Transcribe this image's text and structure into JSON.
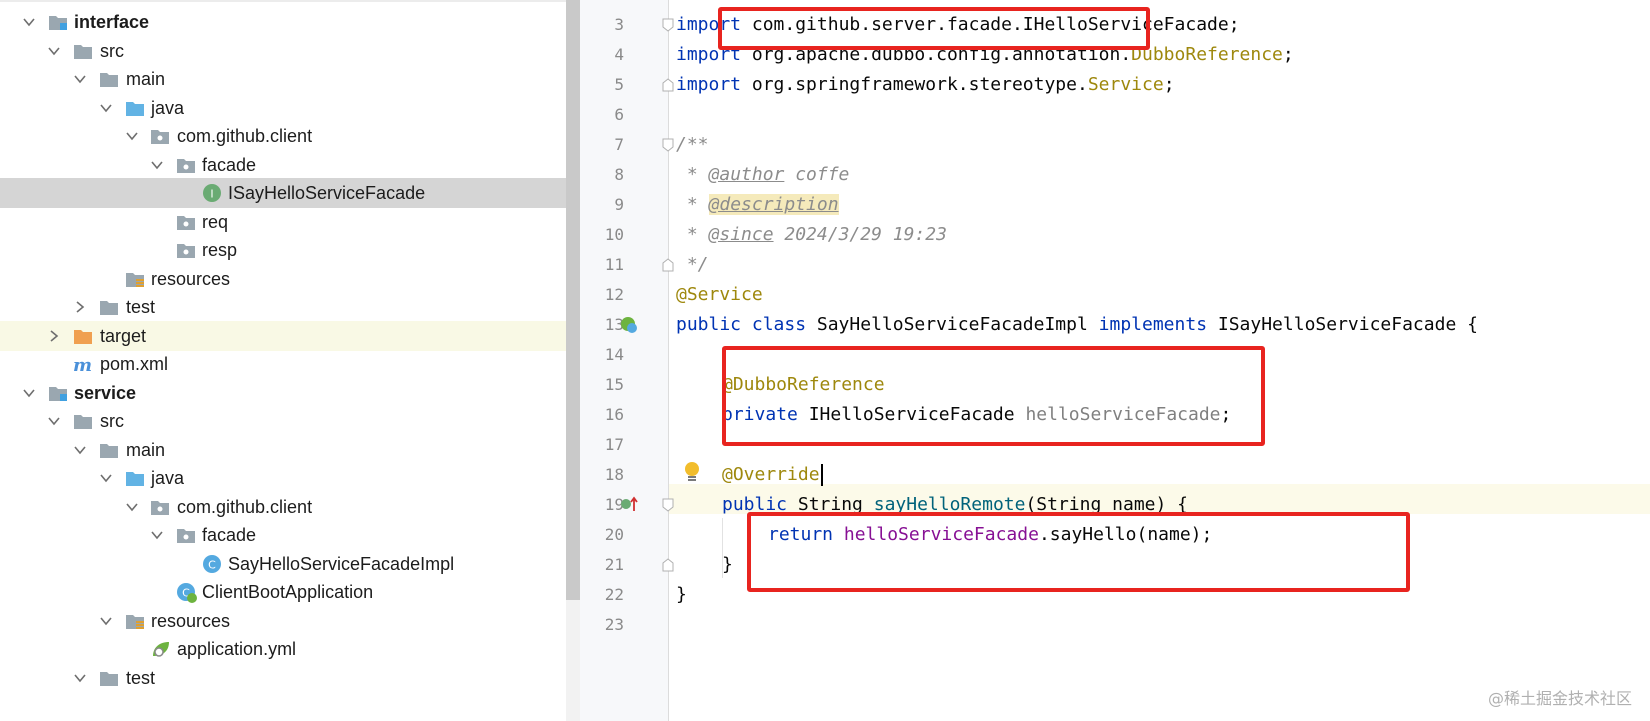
{
  "project_tree": {
    "items": [
      {
        "label": "interface",
        "icon": "module-folder-icon",
        "bold": true
      },
      {
        "label": "src",
        "icon": "folder-icon"
      },
      {
        "label": "main",
        "icon": "folder-icon"
      },
      {
        "label": "java",
        "icon": "source-folder-icon"
      },
      {
        "label": "com.github.client",
        "icon": "package-icon"
      },
      {
        "label": "facade",
        "icon": "package-icon"
      },
      {
        "label": "ISayHelloServiceFacade",
        "icon": "interface-icon",
        "selected": true
      },
      {
        "label": "req",
        "icon": "package-icon"
      },
      {
        "label": "resp",
        "icon": "package-icon"
      },
      {
        "label": "resources",
        "icon": "resources-folder-icon"
      },
      {
        "label": "test",
        "icon": "folder-icon",
        "collapsed": true
      },
      {
        "label": "target",
        "icon": "excluded-folder-icon",
        "collapsed": true
      },
      {
        "label": "pom.xml",
        "icon": "maven-icon"
      },
      {
        "label": "service",
        "icon": "module-folder-icon",
        "bold": true
      },
      {
        "label": "src",
        "icon": "folder-icon"
      },
      {
        "label": "main",
        "icon": "folder-icon"
      },
      {
        "label": "java",
        "icon": "source-folder-icon"
      },
      {
        "label": "com.github.client",
        "icon": "package-icon"
      },
      {
        "label": "facade",
        "icon": "package-icon"
      },
      {
        "label": "SayHelloServiceFacadeImpl",
        "icon": "class-icon"
      },
      {
        "label": "ClientBootApplication",
        "icon": "spring-boot-class-icon"
      },
      {
        "label": "resources",
        "icon": "resources-folder-icon"
      },
      {
        "label": "application.yml",
        "icon": "spring-config-icon"
      },
      {
        "label": "test",
        "icon": "folder-icon"
      }
    ]
  },
  "editor": {
    "line_numbers": [
      "3",
      "4",
      "5",
      "6",
      "7",
      "8",
      "9",
      "10",
      "11",
      "12",
      "13",
      "14",
      "15",
      "16",
      "17",
      "18",
      "19",
      "20",
      "21",
      "22",
      "23"
    ],
    "tokens": {
      "import": "import",
      "l3_pkg": "com.github.server.facade.IHelloServiceFacade;",
      "l4_pkg": "org.apache.dubbo.config.annotation.",
      "l4_cls": "DubboReference",
      "l5_pkg": "org.springframework.stereotype.",
      "l5_cls": "Service",
      "semicolon": ";",
      "l7": "/**",
      "l8_star": " * ",
      "l8_tag": "@author",
      "l8_val": " coffe",
      "l9_tag": "@description",
      "l10_tag": "@since",
      "l10_val": " 2024/3/29 19:23",
      "l11": " */",
      "l12": "@Service",
      "l13_kw": "public class",
      "l13_name": " SayHelloServiceFacadeImpl ",
      "l13_impl": "implements",
      "l13_rest": " ISayHelloServiceFacade {",
      "l15": "@DubboReference",
      "l16_kw": "private",
      "l16_type": " IHelloServiceFacade ",
      "l16_field": "helloServiceFacade",
      "l18": "@Override",
      "l19_kw": "public",
      "l19_type": " String ",
      "l19_method": "sayHelloRemote",
      "l19_rest": "(String name) {",
      "l20_kw": "return",
      "l20_field": "helloServiceFacade",
      "l20_rest": ".sayHello(name);",
      "l21": "}",
      "l22": "}"
    }
  },
  "watermark": "@稀土掘金技术社区",
  "colors": {
    "keyword": "#0033b3",
    "annotation": "#9e880d",
    "comment": "#8c8c8c",
    "field": "#871094",
    "highlight_box": "#e8241f",
    "selected_row": "#d5d5d5"
  }
}
